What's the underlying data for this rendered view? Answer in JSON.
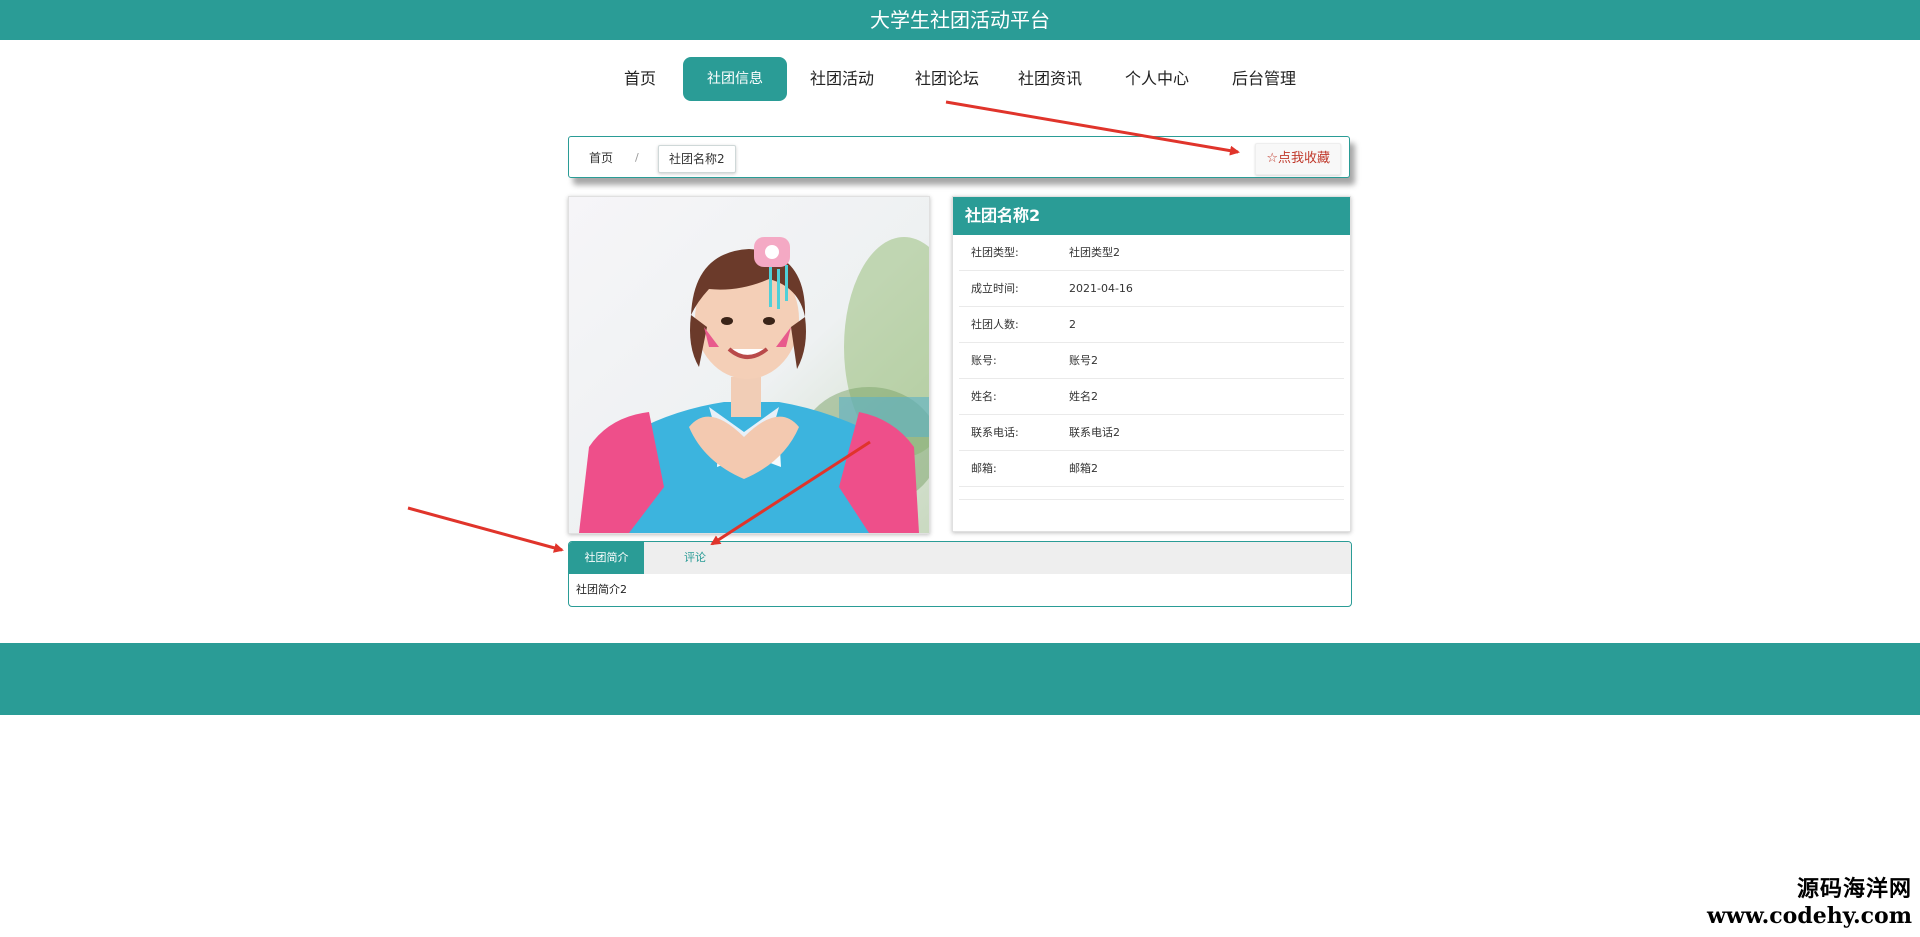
{
  "app": {
    "title": "大学生社团活动平台"
  },
  "nav": {
    "items": [
      {
        "label": "首页"
      },
      {
        "label": "社团信息",
        "active": true
      },
      {
        "label": "社团活动"
      },
      {
        "label": "社团论坛"
      },
      {
        "label": "社团资讯"
      },
      {
        "label": "个人中心"
      },
      {
        "label": "后台管理"
      }
    ]
  },
  "breadcrumb": {
    "home": "首页",
    "separator": "/",
    "current": "社团名称2",
    "favorite_label": "☆点我收藏"
  },
  "club": {
    "image_icon": "club-photo",
    "title": "社团名称2",
    "fields": [
      {
        "label": "社团类型:",
        "value": "社团类型2"
      },
      {
        "label": "成立时间:",
        "value": "2021-04-16"
      },
      {
        "label": "社团人数:",
        "value": "2"
      },
      {
        "label": "账号:",
        "value": "账号2"
      },
      {
        "label": "姓名:",
        "value": "姓名2"
      },
      {
        "label": "联系电话:",
        "value": "联系电话2"
      },
      {
        "label": "邮箱:",
        "value": "邮箱2"
      }
    ]
  },
  "tabs": {
    "items": [
      {
        "label": "社团简介",
        "active": true
      },
      {
        "label": "评论"
      }
    ],
    "content": "社团简介2"
  },
  "watermark": {
    "name": "源码海洋网",
    "url": "www.codehy.com"
  },
  "colors": {
    "primary": "#2a9c96",
    "arrow": "#e0342b",
    "favorite": "#c0392b"
  }
}
